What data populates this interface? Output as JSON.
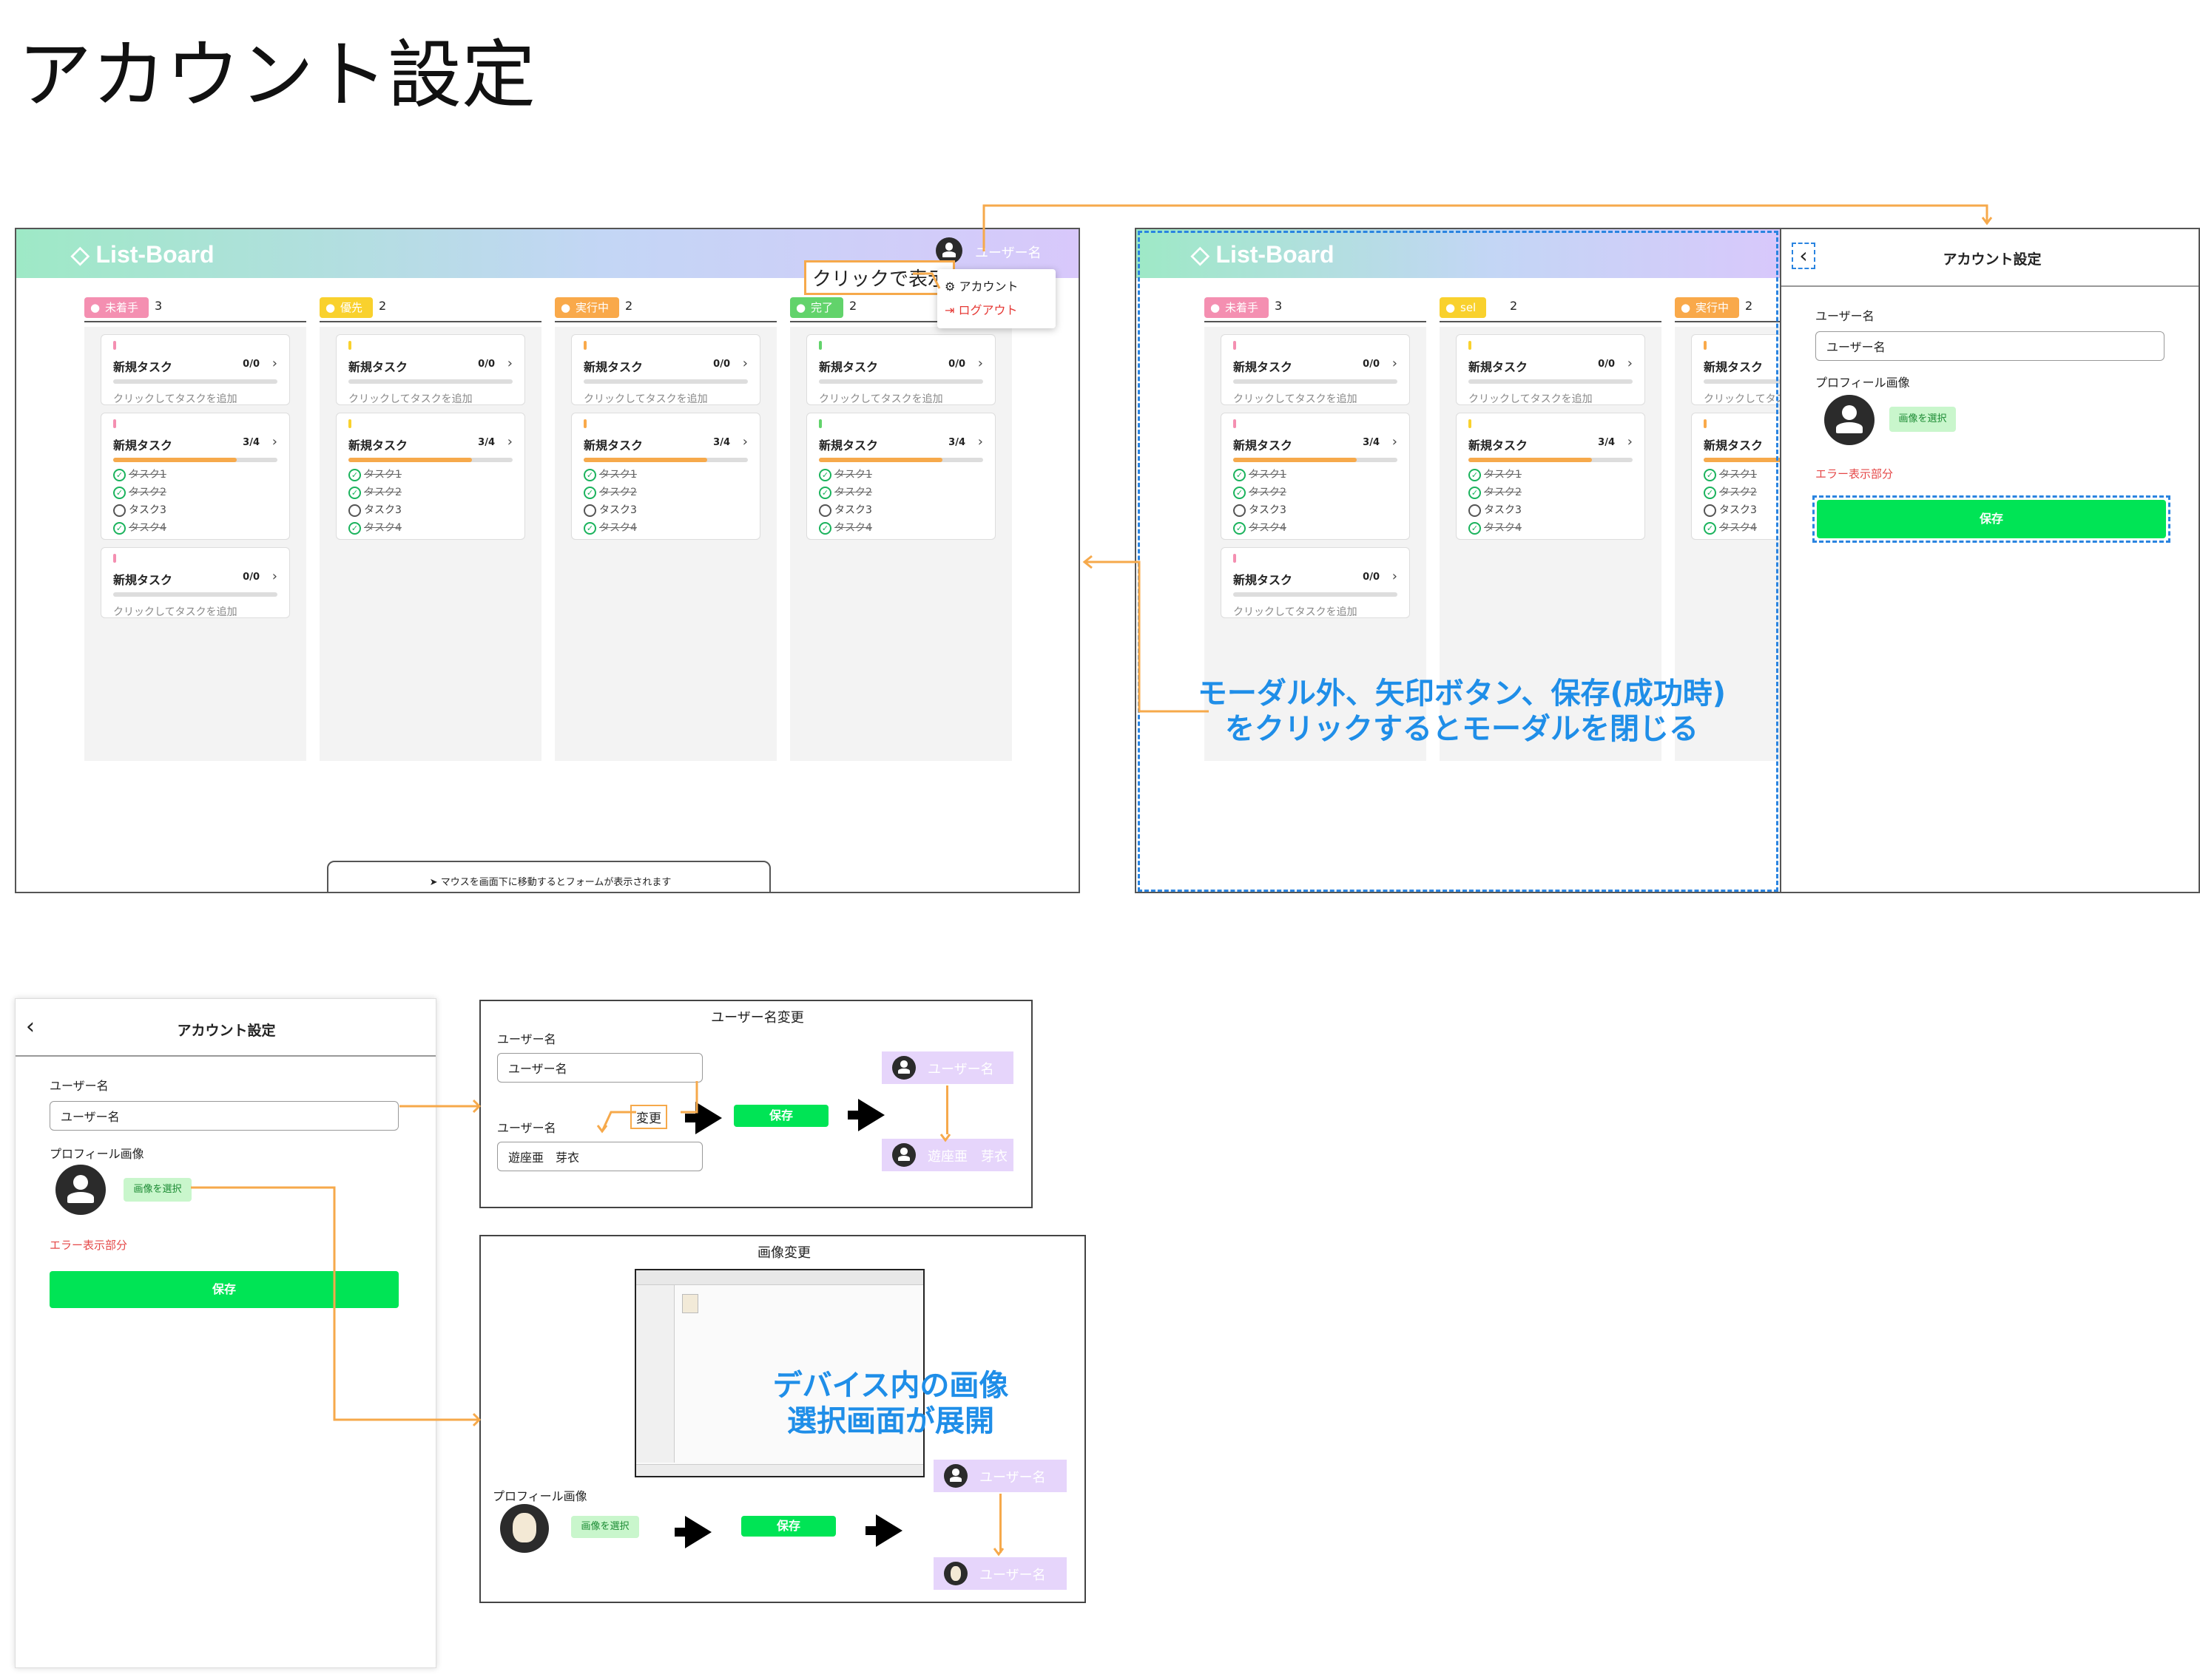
{
  "page_title": "アカウント設定",
  "app": {
    "logo": "List-Board",
    "username": "ユーザー名",
    "hint": "マウスを画面下に移動するとフォームが表示されます"
  },
  "columns": [
    {
      "label": "未着手",
      "count": "3",
      "color": "#f48fb1"
    },
    {
      "label": "優先",
      "count": "2",
      "color": "#f9d12d"
    },
    {
      "label": "実行中",
      "count": "2",
      "color": "#f9a94a"
    },
    {
      "label": "完了",
      "count": "2",
      "color": "#62d36b"
    }
  ],
  "columns_right": [
    {
      "label": "未着手",
      "count": "3",
      "color": "#f48fb1"
    },
    {
      "label": "sel",
      "count": "2",
      "color": "#f9d12d"
    },
    {
      "label": "実行中",
      "count": "2",
      "color": "#f9a94a"
    }
  ],
  "card": {
    "title": "新規タスク",
    "progress_empty": "0/0",
    "progress_partial": "3/4",
    "add_hint": "クリックしてタスクを追加",
    "subtasks": [
      "タスク1",
      "タスク2",
      "タスク3",
      "タスク4"
    ]
  },
  "dropdown": {
    "trigger_note": "クリックで表示",
    "account": "アカウント",
    "logout": "ログアウト"
  },
  "modal": {
    "title": "アカウント設定",
    "username_label": "ユーザー名",
    "username_value": "ユーザー名",
    "image_label": "プロフィール画像",
    "pick_image": "画像を選択",
    "error_text": "エラー表示部分",
    "save": "保存"
  },
  "annotations": {
    "close_modal": "モーダル外、矢印ボタン、保存(成功時)をクリックするとモーダルを閉じる",
    "device_picker": "デバイス内の画像選択画面が展開"
  },
  "rename_box": {
    "title": "ユーザー名変更",
    "label": "ユーザー名",
    "old_value": "ユーザー名",
    "change_note": "変更",
    "new_value": "遊座亜　芽衣",
    "save": "保存",
    "before_name": "ユーザー名",
    "after_name": "遊座亜　芽衣"
  },
  "image_box": {
    "title": "画像変更",
    "label": "プロフィール画像",
    "pick_image": "画像を選択",
    "save": "保存",
    "before_name": "ユーザー名",
    "after_name": "ユーザー名"
  }
}
